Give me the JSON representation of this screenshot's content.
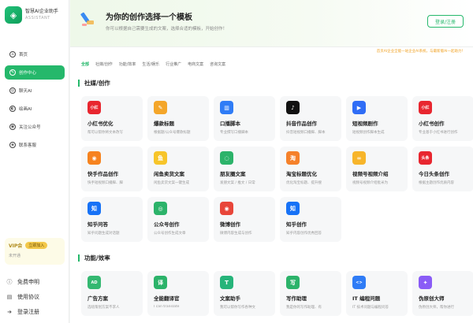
{
  "brand": {
    "name": "智慧AI企业助手",
    "sub": "ASSISTANT"
  },
  "nav": [
    {
      "label": "首页",
      "icon": "home-icon",
      "glyph": "⌂"
    },
    {
      "label": "创作中心",
      "icon": "pen-icon",
      "glyph": "✎"
    },
    {
      "label": "聊天AI",
      "icon": "chat-icon",
      "glyph": "◎"
    },
    {
      "label": "绘画AI",
      "icon": "paint-icon",
      "glyph": "◐"
    },
    {
      "label": "关注公众号",
      "icon": "wechat-icon",
      "glyph": "◉"
    },
    {
      "label": "联系客服",
      "icon": "location-icon",
      "glyph": "◈"
    }
  ],
  "vip": {
    "title": "VIP会",
    "button": "立即加入",
    "sub": "未开通"
  },
  "bottom_links": [
    {
      "label": "免费申明",
      "icon": "info-icon",
      "glyph": "ⓘ"
    },
    {
      "label": "使用协议",
      "icon": "book-icon",
      "glyph": "▤"
    },
    {
      "label": "登录注册",
      "icon": "login-icon",
      "glyph": "➜"
    }
  ],
  "header": {
    "title": "为你的创作选择一个模板",
    "subtitle": "你可以根据自己需要生成的文案，选择合适的模板，开始创作！",
    "login_button": "登录/注册"
  },
  "notice": "首页AI企业全能一站企业AI系统，与最新版AI一起助力！",
  "tabs": [
    "全部",
    "社媒/创作",
    "功能/效率",
    "生活/娱乐",
    "行业推广",
    "电商文案",
    "咨询文案"
  ],
  "sections": [
    {
      "title": "社媒/创作"
    },
    {
      "title": "功能/效率"
    }
  ],
  "cards": [
    {
      "title": "小红书优化",
      "desc": "帮可以帮你将文本改写",
      "icon": "xiaohongshu-icon",
      "glyph": "小红",
      "color": "#e8262f",
      "section": 0,
      "row": 0,
      "col": 0
    },
    {
      "title": "爆款标题",
      "desc": "根据题/公众号爆款标题",
      "icon": "edit-icon",
      "glyph": "✎",
      "color": "#f4a62a",
      "section": 0,
      "row": 0,
      "col": 1
    },
    {
      "title": "口播脚本",
      "desc": "专业撰写口播脚本",
      "icon": "script-icon",
      "glyph": "▥",
      "color": "#2f7cf6",
      "section": 0,
      "row": 0,
      "col": 2
    },
    {
      "title": "抖音作品创作",
      "desc": "抖音短视频口播脚、脚本",
      "icon": "douyin-icon",
      "glyph": "♪",
      "color": "#111111",
      "section": 0,
      "row": 0,
      "col": 3
    },
    {
      "title": "短视频剧作",
      "desc": "短视频创作脚本生成",
      "icon": "play-icon",
      "glyph": "▶",
      "color": "#2f6df6",
      "section": 0,
      "row": 0,
      "col": 4
    },
    {
      "title": "小红书创作",
      "desc": "专业基于小红书进行创作",
      "icon": "xiaohongshu-icon",
      "glyph": "小红",
      "color": "#e8262f",
      "section": 0,
      "row": 0,
      "col": 5
    },
    {
      "title": "快手作品创作",
      "desc": "快手短视频口播脚、脚",
      "icon": "kuaishou-icon",
      "glyph": "◉",
      "color": "#f6831f",
      "section": 0,
      "row": 1,
      "col": 0
    },
    {
      "title": "闲鱼卖货文案",
      "desc": "闲鱼卖货文案一键生成",
      "icon": "xianyu-icon",
      "glyph": "鱼",
      "color": "#f7c52a",
      "section": 0,
      "row": 1,
      "col": 1
    },
    {
      "title": "朋友圈文案",
      "desc": "发朋文案 / 推文 / 日常",
      "icon": "moments-icon",
      "glyph": "◌",
      "color": "#2cb36a",
      "section": 0,
      "row": 1,
      "col": 2
    },
    {
      "title": "淘宝标题优化",
      "desc": "优化淘宝标题、提升搜",
      "icon": "taobao-icon",
      "glyph": "淘",
      "color": "#f5812a",
      "section": 0,
      "row": 1,
      "col": 3
    },
    {
      "title": "视频号视频介绍",
      "desc": "视频号视频介绍批米为",
      "icon": "channels-icon",
      "glyph": "∞",
      "color": "#f7b52a",
      "section": 0,
      "row": 1,
      "col": 4
    },
    {
      "title": "今日头条创作",
      "desc": "根据主题创作优质内容",
      "icon": "toutiao-icon",
      "glyph": "头条",
      "color": "#e8262f",
      "section": 0,
      "row": 1,
      "col": 5
    },
    {
      "title": "知乎问答",
      "desc": "知乎问题生成对话题",
      "icon": "zhihu-icon",
      "glyph": "知",
      "color": "#1772f6",
      "section": 0,
      "row": 2,
      "col": 0
    },
    {
      "title": "公众号创作",
      "desc": "公众号创作生成文章",
      "icon": "wechat-icon",
      "glyph": "◎",
      "color": "#2cb36a",
      "section": 0,
      "row": 2,
      "col": 1
    },
    {
      "title": "微博创作",
      "desc": "微博内容生成与创作",
      "icon": "weibo-icon",
      "glyph": "◉",
      "color": "#e8463a",
      "section": 0,
      "row": 2,
      "col": 2
    },
    {
      "title": "知乎创作",
      "desc": "知乎内容创作优秀回答",
      "icon": "zhihu-icon",
      "glyph": "知",
      "color": "#1772f6",
      "section": 0,
      "row": 2,
      "col": 3
    },
    {
      "title": "广告方案",
      "desc": "选啥策划方案不求人",
      "icon": "ad-icon",
      "glyph": "AD",
      "color": "#34b871",
      "section": 1,
      "row": 0,
      "col": 0
    },
    {
      "title": "全能翻译官",
      "desc": "I can translate",
      "icon": "translate-icon",
      "glyph": "译",
      "color": "#2cb36a",
      "section": 1,
      "row": 0,
      "col": 1
    },
    {
      "title": "文案助手",
      "desc": "我可以帮你写作各种文",
      "icon": "document-icon",
      "glyph": "T",
      "color": "#26b47a",
      "section": 1,
      "row": 0,
      "col": 2
    },
    {
      "title": "写作助理",
      "desc": "我是你的写作助理、有",
      "icon": "write-icon",
      "glyph": "写",
      "color": "#2cb36a",
      "section": 1,
      "row": 0,
      "col": 3
    },
    {
      "title": "IT 编程问题",
      "desc": "IT 技术问题与编程问答",
      "icon": "code-icon",
      "glyph": "<>",
      "color": "#2f7cf6",
      "section": 1,
      "row": 0,
      "col": 4
    },
    {
      "title": "伪原创大师",
      "desc": "伪原创大师，帮你进行",
      "icon": "magic-icon",
      "glyph": "✦",
      "color": "#8a5cf6",
      "section": 1,
      "row": 0,
      "col": 5
    }
  ]
}
